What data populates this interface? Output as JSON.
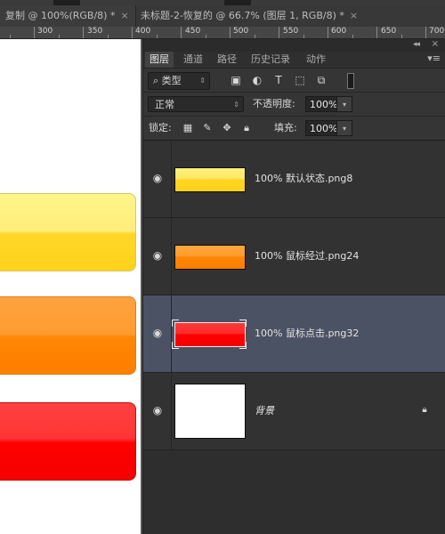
{
  "tabs": [
    {
      "label": "复制 @ 100%(RGB/8) *",
      "close": "×"
    },
    {
      "label": "未标题-2-恢复的 @ 66.7% (图层 1, RGB/8) *",
      "close": "×"
    }
  ],
  "ruler": {
    "labels": [
      "300",
      "350",
      "400",
      "450",
      "500",
      "550",
      "600",
      "650",
      "700"
    ]
  },
  "panel": {
    "tabs": [
      "图层",
      "通道",
      "路径",
      "历史记录",
      "动作"
    ],
    "filter_type": "类型",
    "blend_mode": "正常",
    "opacity_label": "不透明度:",
    "opacity_value": "100%",
    "lock_label": "锁定:",
    "fill_label": "填充:",
    "fill_value": "100%"
  },
  "layers": [
    {
      "name": "100%  默认状态.png8",
      "visible": true,
      "swatch": "#ffd92b"
    },
    {
      "name": "100%  鼠标经过.png24",
      "visible": true,
      "swatch": "#ff8f15"
    },
    {
      "name": "100% 鼠标点击.png32",
      "visible": true,
      "swatch": "#ff0000",
      "selected": true
    },
    {
      "name": "背景",
      "visible": true,
      "swatch": "#ffffff",
      "locked": true
    }
  ],
  "colors": {
    "selected_layer": "#4b5263",
    "panel_bg": "#333333"
  }
}
